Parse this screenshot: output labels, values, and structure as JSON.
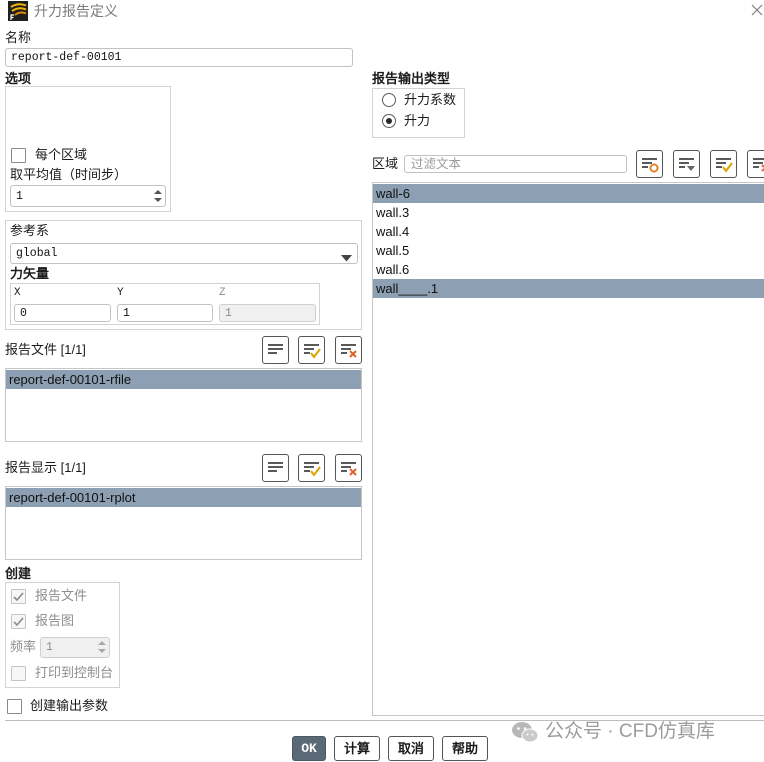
{
  "window": {
    "title": "升力报告定义",
    "app_icon": "fluent-app-icon",
    "close_icon": "close-icon"
  },
  "name": {
    "label": "名称",
    "value": "report-def-00101"
  },
  "options": {
    "label": "选项",
    "per_zone": {
      "label": "每个区域",
      "checked": false
    },
    "average_over": {
      "label": "取平均值（时间步）",
      "value": "1"
    }
  },
  "reference_frame": {
    "label": "参考系",
    "value": "global"
  },
  "force_vector": {
    "label": "力矢量",
    "x": {
      "label": "X",
      "value": "0"
    },
    "y": {
      "label": "Y",
      "value": "1"
    },
    "z": {
      "label": "Z",
      "value": "1"
    }
  },
  "report_files": {
    "label": "报告文件 [1/1]",
    "items": [
      {
        "label": "report-def-00101-rfile",
        "selected": true
      }
    ]
  },
  "report_plots": {
    "label": "报告显示 [1/1]",
    "items": [
      {
        "label": "report-def-00101-rplot",
        "selected": true
      }
    ]
  },
  "list_tools": {
    "select_all": "list-select-all-icon",
    "select_checked": "list-check-icon",
    "deselect": "list-deselect-icon",
    "match": "list-filter-circle-icon",
    "sort": "list-dropdown-icon"
  },
  "create": {
    "label": "创建",
    "report_file": {
      "label": "报告文件",
      "checked": true
    },
    "report_plot": {
      "label": "报告图",
      "checked": true
    },
    "frequency": {
      "label": "频率",
      "value": "1"
    },
    "print_to_console": {
      "label": "打印到控制台",
      "checked": false
    }
  },
  "create_output_parameter": {
    "label": "创建输出参数",
    "checked": false
  },
  "report_output_type": {
    "label": "报告输出类型",
    "options": [
      {
        "label": "升力系数",
        "checked": false
      },
      {
        "label": "升力",
        "checked": true
      }
    ]
  },
  "zones": {
    "label": "区域",
    "filter_placeholder": "过滤文本",
    "items": [
      {
        "label": "wall-6",
        "selected": true
      },
      {
        "label": "wall.3",
        "selected": false
      },
      {
        "label": "wall.4",
        "selected": false
      },
      {
        "label": "wall.5",
        "selected": false
      },
      {
        "label": "wall.6",
        "selected": false
      },
      {
        "label": "wall____.1",
        "selected": true
      }
    ]
  },
  "buttons": {
    "ok": "OK",
    "compute": "计算",
    "cancel": "取消",
    "help": "帮助"
  },
  "watermark": {
    "icon": "wechat-icon",
    "text": "公众号 · CFD仿真库"
  },
  "colors": {
    "selection": "#8c9fb3",
    "ok_button": "#5b6977",
    "accent_check": "#d9a400",
    "accent_cross": "#e0622a"
  }
}
